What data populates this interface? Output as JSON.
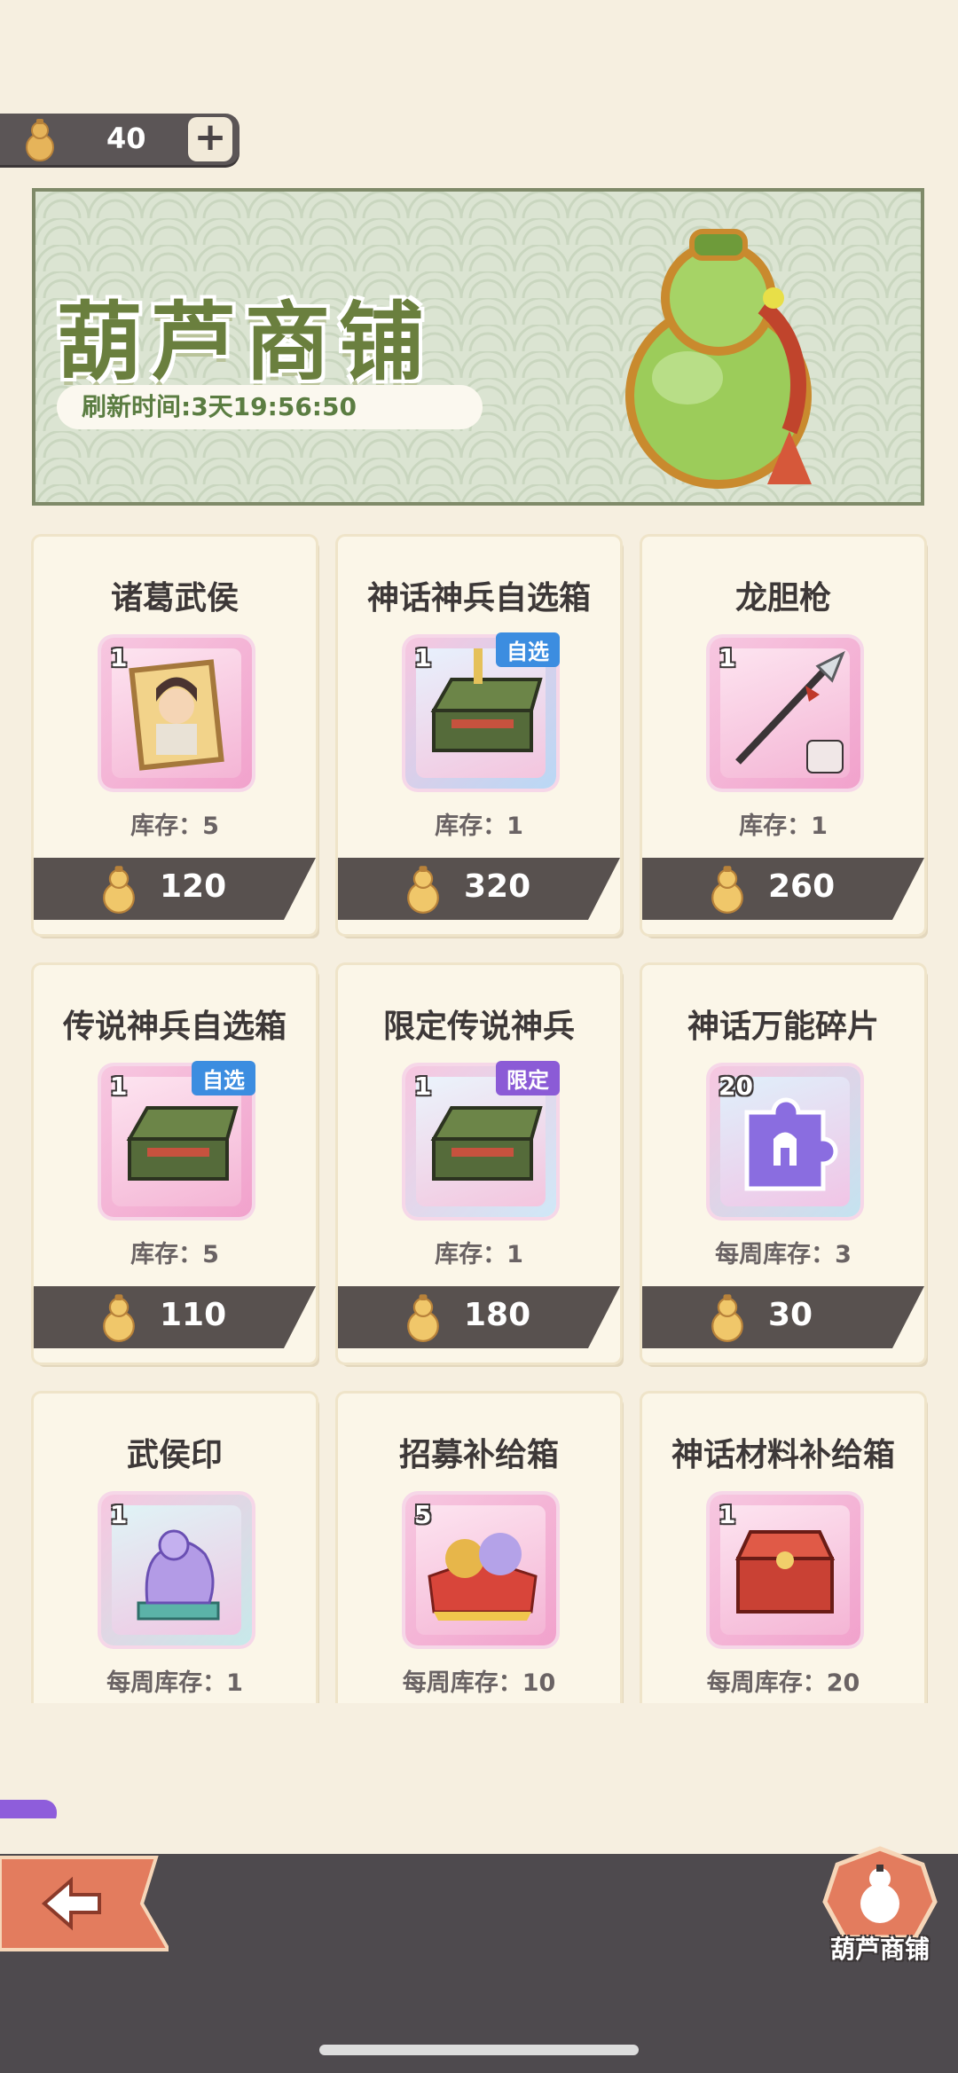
{
  "currency": {
    "amount": "40",
    "plus_label": "+"
  },
  "banner": {
    "title": "葫芦商铺",
    "refresh_label": "刷新时间:3天19:56:50"
  },
  "items": [
    {
      "name": "诸葛武侯",
      "qty": "1",
      "tag": "",
      "stock": "库存：5",
      "price": "120",
      "art": "portrait"
    },
    {
      "name": "神话神兵自选箱",
      "qty": "1",
      "tag": "自选",
      "stock": "库存：1",
      "price": "320",
      "art": "chest"
    },
    {
      "name": "龙胆枪",
      "qty": "1",
      "tag": "",
      "stock": "库存：1",
      "price": "260",
      "art": "spear"
    },
    {
      "name": "传说神兵自选箱",
      "qty": "1",
      "tag": "自选",
      "stock": "库存：5",
      "price": "110",
      "art": "chest"
    },
    {
      "name": "限定传说神兵",
      "qty": "1",
      "tag": "限定",
      "stock": "库存：1",
      "price": "180",
      "art": "chest"
    },
    {
      "name": "神话万能碎片",
      "qty": "20",
      "tag": "",
      "stock": "每周库存：3",
      "price": "30",
      "art": "fragment"
    },
    {
      "name": "武侯印",
      "qty": "1",
      "tag": "",
      "stock": "每周库存：1",
      "price": "",
      "art": "seal"
    },
    {
      "name": "招募补给箱",
      "qty": "5",
      "tag": "",
      "stock": "每周库存：10",
      "price": "",
      "art": "crate"
    },
    {
      "name": "神话材料补给箱",
      "qty": "1",
      "tag": "",
      "stock": "每周库存：20",
      "price": "",
      "art": "redchest"
    }
  ],
  "nav": {
    "shop_tab_label": "葫芦商铺"
  },
  "colors": {
    "accent_green": "#6a7f3e",
    "price_bar": "#58514f",
    "tag_blue": "#3c8de0",
    "tag_purple": "#8b5bd6"
  },
  "icons": [
    "gourd-icon",
    "plus-icon",
    "back-arrow-icon",
    "shop-tab-icon"
  ]
}
